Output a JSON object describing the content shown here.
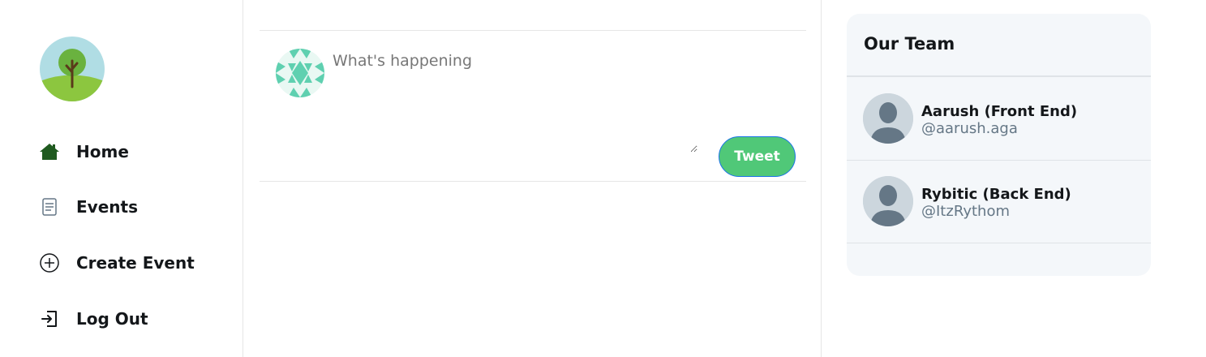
{
  "sidebar": {
    "logo_icon": "tree-logo-icon",
    "items": [
      {
        "label": "Home",
        "icon": "home-icon"
      },
      {
        "label": "Events",
        "icon": "document-icon"
      },
      {
        "label": "Create Event",
        "icon": "plus-circle-icon"
      },
      {
        "label": "Log Out",
        "icon": "logout-icon"
      }
    ]
  },
  "composer": {
    "placeholder": "What's happening",
    "value": "",
    "avatar_icon": "identicon-avatar",
    "tweet_label": "Tweet"
  },
  "widgets": {
    "title": "Our Team",
    "members": [
      {
        "name": "Aarush (Front End)",
        "handle": "@aarush.aga",
        "avatar_icon": "default-user-avatar"
      },
      {
        "name": "Rybitic (Back End)",
        "handle": "@ItzRythom",
        "avatar_icon": "default-user-avatar"
      }
    ]
  },
  "colors": {
    "accent_green": "#50c878",
    "identicon": "#5fd0b0",
    "widget_bg": "#f4f7fa",
    "home_icon": "#1f5a1f"
  }
}
